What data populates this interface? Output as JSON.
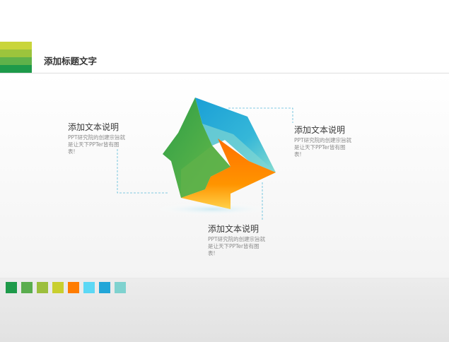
{
  "header": {
    "title": "添加标题文字"
  },
  "colors": {
    "stripes": [
      "#c9d53a",
      "#9cc43c",
      "#5fb24a",
      "#1e9a4a"
    ],
    "swatches": [
      "#1e9a4a",
      "#5aad4e",
      "#9cbf3d",
      "#c9cf2e",
      "#ff7c00",
      "#5cd8f5",
      "#22a6d8",
      "#7fd2cf"
    ],
    "arrow_blue": "#1fa5d8",
    "arrow_green": "#4fae48",
    "arrow_orange": "#ff7a00",
    "dashed_line": "#5bbbd9"
  },
  "callouts": [
    {
      "heading": "添加文本说明",
      "body": "PPT研究院的创建宗旨就是让天下PPTer皆有图表!"
    },
    {
      "heading": "添加文本说明",
      "body": "PPT研究院的创建宗旨就是让天下PPTer皆有图表!"
    },
    {
      "heading": "添加文本说明",
      "body": "PPT研究院的创建宗旨就是让天下PPTer皆有图表!"
    }
  ]
}
